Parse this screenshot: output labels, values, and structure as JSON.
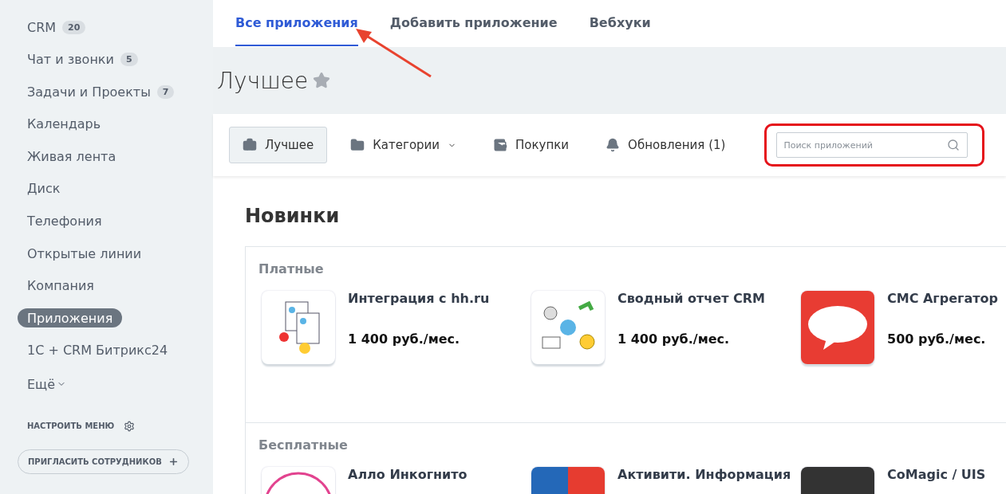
{
  "sidebar": {
    "items": [
      {
        "label": "CRM",
        "counter": "20",
        "selected": false
      },
      {
        "label": "Чат и звонки",
        "counter": "5",
        "selected": false
      },
      {
        "label": "Задачи и Проекты",
        "counter": "7",
        "selected": false
      },
      {
        "label": "Календарь",
        "selected": false
      },
      {
        "label": "Живая лента",
        "selected": false
      },
      {
        "label": "Диск",
        "selected": false
      },
      {
        "label": "Телефония",
        "selected": false
      },
      {
        "label": "Открытые линии",
        "selected": false
      },
      {
        "label": "Компания",
        "selected": false
      },
      {
        "label": "Приложения",
        "selected": true
      },
      {
        "label": "1С + CRM Битрикс24",
        "selected": false
      }
    ],
    "more": "Ещё",
    "configure": "НАСТРОИТЬ МЕНЮ",
    "invite": "ПРИГЛАСИТЬ СОТРУДНИКОВ"
  },
  "tabs": [
    {
      "label": "Все приложения",
      "selected": true
    },
    {
      "label": "Добавить приложение",
      "selected": false
    },
    {
      "label": "Вебхуки",
      "selected": false
    }
  ],
  "title": "Лучшее",
  "toolbar": [
    {
      "label": "Лучшее",
      "kind": "best",
      "selected": true
    },
    {
      "label": "Категории",
      "kind": "categories",
      "selected": false
    },
    {
      "label": "Покупки",
      "kind": "purchases",
      "selected": false
    },
    {
      "label": "Обновления (1)",
      "kind": "updates",
      "selected": false
    }
  ],
  "search": {
    "placeholder": "Поиск приложений"
  },
  "heading": "Новинки",
  "sections": [
    {
      "title": "Платные",
      "apps": [
        {
          "name": "Интеграция с hh.ru",
          "price": "1 400 руб./мес.",
          "kind": "hh"
        },
        {
          "name": "Сводный отчет CRM",
          "price": "1 400 руб./мес.",
          "kind": "report"
        },
        {
          "name": "СМС Агрегатор",
          "price": "500 руб./мес.",
          "kind": "sms"
        }
      ]
    },
    {
      "title": "Бесплатные",
      "apps": [
        {
          "name": "Алло Инкогнито",
          "kind": "ring"
        },
        {
          "name": "Активити. Информация",
          "kind": "split"
        },
        {
          "name": "CoMagic / UIS",
          "kind": "dark"
        }
      ]
    }
  ]
}
